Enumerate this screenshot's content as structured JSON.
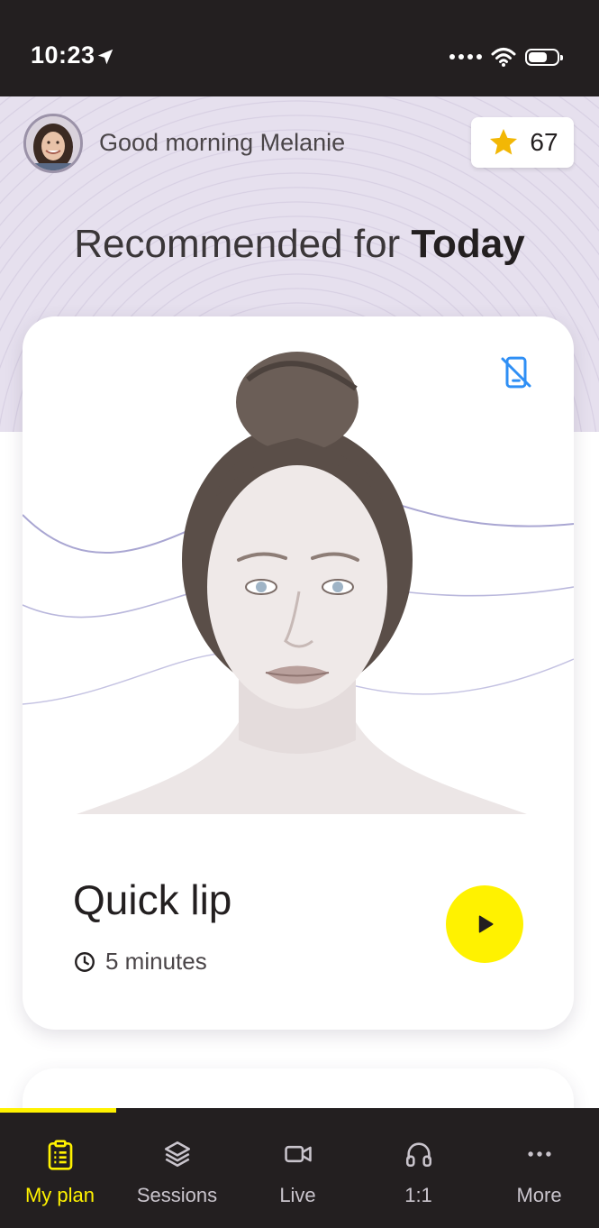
{
  "status_bar": {
    "time": "10:23"
  },
  "header": {
    "greeting": "Good morning Melanie",
    "points": "67",
    "rec_title_prefix": "Recommended for ",
    "rec_title_bold": "Today"
  },
  "card": {
    "title": "Quick lip",
    "duration": "5 minutes"
  },
  "tabs": [
    {
      "label": "My plan",
      "icon": "clipboard-icon",
      "active": true
    },
    {
      "label": "Sessions",
      "icon": "layers-icon"
    },
    {
      "label": "Live",
      "icon": "video-icon"
    },
    {
      "label": "1:1",
      "icon": "headphones-icon"
    },
    {
      "label": "More",
      "icon": "more-icon"
    }
  ],
  "colors": {
    "accent": "#fff200",
    "dark": "#231f20",
    "header_bg": "#e6e0ee",
    "icon_blue": "#2f8ff5"
  }
}
